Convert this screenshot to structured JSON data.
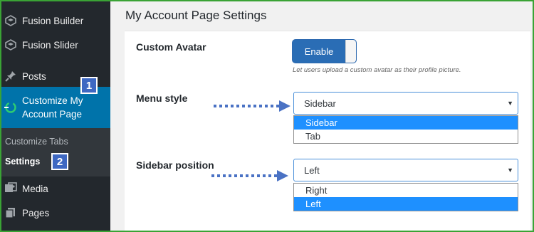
{
  "sidebar": {
    "items": [
      {
        "label": "Fusion Builder",
        "icon": "fusion-builder-icon"
      },
      {
        "label": "Fusion Slider",
        "icon": "fusion-slider-icon"
      },
      {
        "label": "Posts",
        "icon": "pin-icon"
      },
      {
        "label": "Customize My Account Page",
        "icon": "customize-icon",
        "current": true
      },
      {
        "label": "Media",
        "icon": "media-icon"
      },
      {
        "label": "Pages",
        "icon": "pages-icon"
      }
    ],
    "submenu": [
      {
        "label": "Customize Tabs"
      },
      {
        "label": "Settings",
        "active": true
      }
    ]
  },
  "annotations": {
    "badge_1": "1",
    "badge_2": "2"
  },
  "panel": {
    "title": "My Account Page Settings",
    "custom_avatar": {
      "label": "Custom Avatar",
      "toggle_label": "Enable",
      "help": "Let users upload a custom avatar as their profile picture."
    },
    "menu_style": {
      "label": "Menu style",
      "selected": "Sidebar",
      "options": [
        "Sidebar",
        "Tab"
      ],
      "highlighted": "Sidebar"
    },
    "sidebar_position": {
      "label": "Sidebar position",
      "selected": "Left",
      "options": [
        "Right",
        "Left"
      ],
      "highlighted": "Left"
    }
  },
  "colors": {
    "sidebar_bg": "#23282d",
    "accent": "#0073aa",
    "badge": "#3e68c2",
    "frame": "#3aa335",
    "option_highlight": "#1e90ff"
  }
}
